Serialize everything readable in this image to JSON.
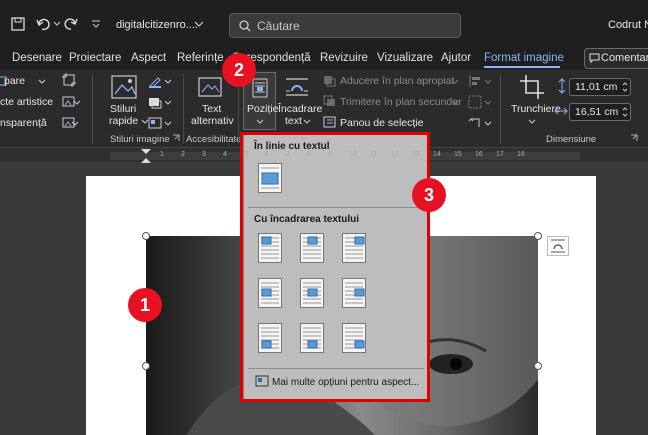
{
  "titlebar": {
    "filename": "digitalcitizenro....",
    "search_placeholder": "Căutare",
    "user": "Codrut N"
  },
  "tabs": [
    {
      "label": "Desenare"
    },
    {
      "label": "Proiectare"
    },
    {
      "label": "Aspect"
    },
    {
      "label": "Referințe"
    },
    {
      "label": "Corespondență"
    },
    {
      "label": "Revizuire"
    },
    {
      "label": "Vizualizare"
    },
    {
      "label": "Ajutor"
    },
    {
      "label": "Format imagine",
      "active": true
    }
  ],
  "comment_button": "Comentari",
  "ribbon": {
    "left_items": [
      "pare",
      "cte artistice",
      "nsparență"
    ],
    "stiluri_rapide": "Stiluri",
    "stiluri_rapide2": "rapide",
    "group_stiluri": "Stiluri imagine",
    "text_alt1": "Text",
    "text_alt2": "alternativ",
    "group_access": "Accesibilitate",
    "pozitie": "Poziție",
    "incadrare1": "Încadrare",
    "incadrare2": "text",
    "aducere": "Aducere în plan apropiat",
    "trimitere": "Trimitere în plan secundar",
    "panou": "Panou de selecție",
    "trunchiere": "Trunchiere",
    "height": "11,01 cm",
    "width": "16,51 cm",
    "group_dim": "Dimensiune"
  },
  "ruler_numbers": [
    "1",
    "2",
    "3",
    "4",
    "5",
    "6",
    "7",
    "8",
    "9",
    "10",
    "11",
    "12",
    "13",
    "14",
    "15",
    "16",
    "17",
    "18"
  ],
  "dropdown": {
    "inline_header": "În linie cu textul",
    "wrap_header": "Cu încadrarea textului",
    "more_options": "Mai multe opțiuni pentru aspect..."
  },
  "callouts": [
    "1",
    "2",
    "3"
  ],
  "colors": {
    "accent": "#8ab4f8",
    "callout": "#e81123",
    "highlight": "#e00000"
  }
}
